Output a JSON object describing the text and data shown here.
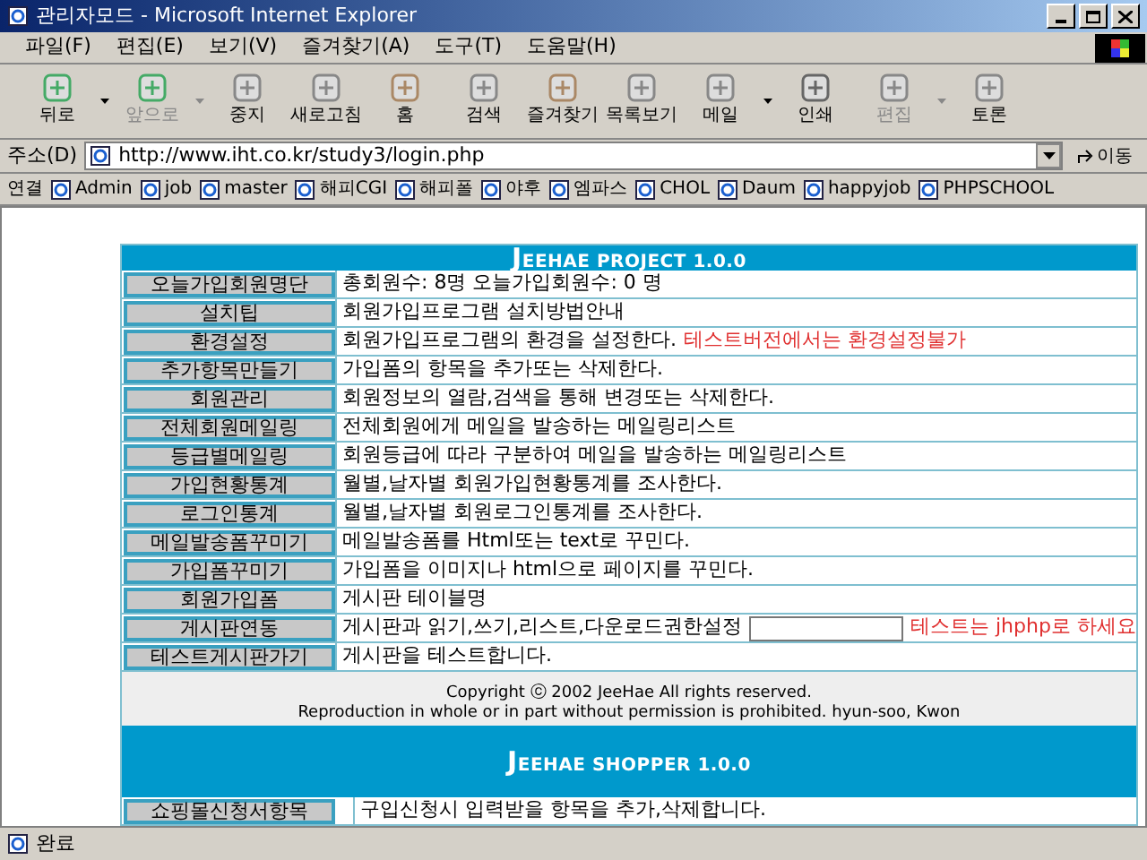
{
  "window": {
    "title": "관리자모드 - Microsoft Internet Explorer"
  },
  "menu": [
    "파일(F)",
    "편집(E)",
    "보기(V)",
    "즐겨찾기(A)",
    "도구(T)",
    "도움말(H)"
  ],
  "toolbar": [
    {
      "label": "뒤로",
      "disabled": false,
      "dropdown": true
    },
    {
      "label": "앞으로",
      "disabled": true,
      "dropdown": true
    },
    {
      "label": "중지",
      "disabled": false,
      "dropdown": false
    },
    {
      "label": "새로고침",
      "disabled": false,
      "dropdown": false
    },
    {
      "label": "홈",
      "disabled": false,
      "dropdown": false
    },
    {
      "label": "검색",
      "disabled": false,
      "dropdown": false
    },
    {
      "label": "즐겨찾기",
      "disabled": false,
      "dropdown": false
    },
    {
      "label": "목록보기",
      "disabled": false,
      "dropdown": false
    },
    {
      "label": "메일",
      "disabled": false,
      "dropdown": true
    },
    {
      "label": "인쇄",
      "disabled": false,
      "dropdown": false
    },
    {
      "label": "편집",
      "disabled": true,
      "dropdown": true
    },
    {
      "label": "토론",
      "disabled": false,
      "dropdown": false
    }
  ],
  "address_bar": {
    "label": "주소(D)",
    "value": "http://www.iht.co.kr/study3/login.php",
    "go": "이동"
  },
  "links_bar": {
    "label": "연결",
    "links": [
      "Admin",
      "job",
      "master",
      "해피CGI",
      "해피폴",
      "야후",
      "엠파스",
      "CHOL",
      "Daum",
      "happyjob",
      "PHPSCHOOL"
    ]
  },
  "project": {
    "title": "JEEHAE PROJECT 1.0.0",
    "rows": [
      {
        "kind": "text",
        "button": "오늘가입회원명단",
        "description": "총회원수: 8명 오늘가입회원수: 0 명"
      },
      {
        "kind": "text",
        "button": "설치팁",
        "description": "회원가입프로그램 설치방법안내"
      },
      {
        "kind": "note",
        "button": "환경설정",
        "description": "회원가입프로그램의 환경을 설정한다.",
        "note": "테스트버전에서는 환경설정불가"
      },
      {
        "kind": "text",
        "button": "추가항목만들기",
        "description": "가입폼의 항목을 추가또는 삭제한다."
      },
      {
        "kind": "text",
        "button": "회원관리",
        "description": "회원정보의 열람,검색을 통해 변경또는 삭제한다."
      },
      {
        "kind": "text",
        "button": "전체회원메일링",
        "description": "전체회원에게 메일을 발송하는 메일링리스트"
      },
      {
        "kind": "text",
        "button": "등급별메일링",
        "description": "회원등급에 따라 구분하여 메일을 발송하는 메일링리스트"
      },
      {
        "kind": "text",
        "button": "가입현황통계",
        "description": "월별,날자별 회원가입현황통계를 조사한다."
      },
      {
        "kind": "text",
        "button": "로그인통계",
        "description": "월별,날자별 회원로그인통계를 조사한다."
      },
      {
        "kind": "text",
        "button": "메일발송폼꾸미기",
        "description": "메일발송폼를 Html또는 text로 꾸민다."
      },
      {
        "kind": "text",
        "button": "가입폼꾸미기",
        "description": "가입폼을 이미지나 html으로 페이지를 꾸민다."
      },
      {
        "kind": "text",
        "button": "회원가입폼",
        "description": "게시판 테이블명"
      },
      {
        "kind": "input",
        "button": "게시판연동",
        "description": "게시판과 읽기,쓰기,리스트,다운로드권한설정",
        "note": "테스트는 jhphp로 하세요"
      },
      {
        "kind": "text",
        "button": "테스트게시판가기",
        "description": "게시판을 테스트합니다."
      }
    ]
  },
  "footer": [
    "Copyright ⓒ 2002 JeeHae All rights reserved.",
    "Reproduction in whole or in part without permission is prohibited. hyun-soo, Kwon"
  ],
  "shopper": {
    "title": "JEEHAE SHOPPER 1.0.0",
    "rows": [
      {
        "kind": "text",
        "button": "쇼핑몰신청서항목",
        "description": "구입신청시 입력받을 항목을 추가,삭제합니다."
      }
    ]
  },
  "status_bar": {
    "text": "완료"
  }
}
